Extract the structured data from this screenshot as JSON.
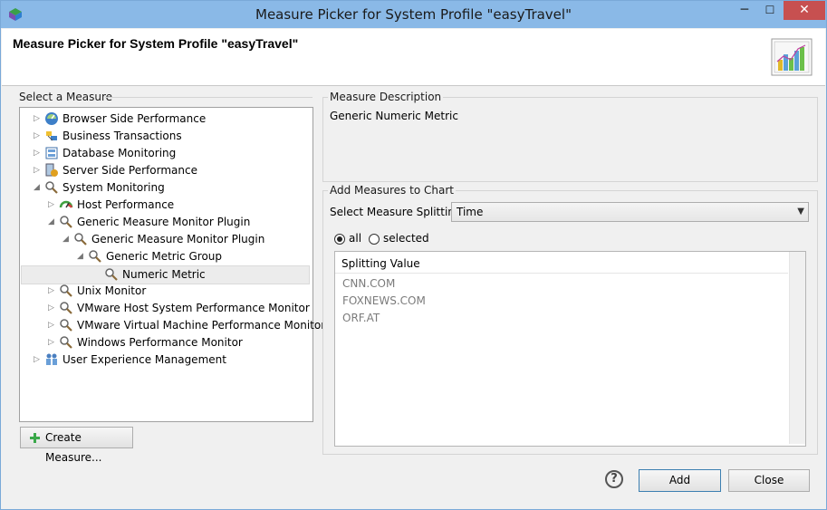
{
  "window": {
    "title": "Measure Picker for System Profile \"easyTravel\"",
    "close_label": "✕",
    "min_label": "─",
    "max_label": "☐"
  },
  "header": {
    "title": "Measure Picker for System Profile \"easyTravel\""
  },
  "left": {
    "group_label": "Select a Measure",
    "tree": [
      {
        "label": "Browser Side Performance",
        "icon": "browser-performance-icon",
        "expander": "collapsed"
      },
      {
        "label": "Business Transactions",
        "icon": "business-transactions-icon",
        "expander": "collapsed"
      },
      {
        "label": "Database Monitoring",
        "icon": "database-icon",
        "expander": "collapsed"
      },
      {
        "label": "Server Side Performance",
        "icon": "server-icon",
        "expander": "collapsed"
      },
      {
        "label": "System Monitoring",
        "icon": "magnifier-icon",
        "expander": "expanded"
      },
      {
        "label": "Host Performance",
        "icon": "gauge-icon",
        "expander": "collapsed"
      },
      {
        "label": "Generic Measure Monitor Plugin",
        "icon": "magnifier-icon",
        "expander": "expanded"
      },
      {
        "label": "Generic Measure Monitor Plugin",
        "icon": "magnifier-icon",
        "expander": "expanded"
      },
      {
        "label": "Generic Metric Group",
        "icon": "magnifier-icon",
        "expander": "expanded"
      },
      {
        "label": "Numeric Metric",
        "icon": "magnifier-icon",
        "expander": "none"
      },
      {
        "label": "Unix Monitor",
        "icon": "magnifier-icon",
        "expander": "collapsed"
      },
      {
        "label": "VMware Host System Performance Monitor",
        "icon": "magnifier-icon",
        "expander": "collapsed"
      },
      {
        "label": "VMware Virtual Machine Performance Monitor",
        "icon": "magnifier-icon",
        "expander": "collapsed"
      },
      {
        "label": "Windows Performance Monitor",
        "icon": "magnifier-icon",
        "expander": "collapsed"
      },
      {
        "label": "User Experience Management",
        "icon": "users-icon",
        "expander": "collapsed"
      }
    ],
    "create_button": "Create Measure..."
  },
  "description": {
    "group_label": "Measure Description",
    "text": "Generic Numeric Metric"
  },
  "add": {
    "group_label": "Add Measures to Chart",
    "splitting_label": "Select Measure Splitting:",
    "splitting_value": "Time",
    "radio_all": "all",
    "radio_selected": "selected",
    "list_header": "Splitting Value",
    "values": [
      "CNN.COM",
      "FOXNEWS.COM",
      "ORF.AT"
    ]
  },
  "footer": {
    "help_label": "?",
    "add_button": "Add",
    "close_button": "Close"
  }
}
